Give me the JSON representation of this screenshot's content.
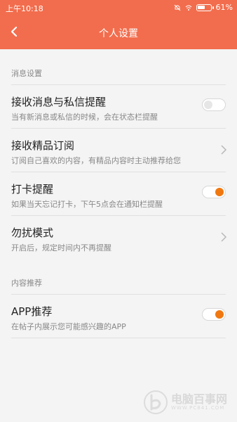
{
  "status": {
    "time": "上午10:18",
    "battery_percent": "61%",
    "battery_level": 0.61
  },
  "header": {
    "title": "个人设置",
    "background": "#f26d4d"
  },
  "sections": [
    {
      "label": "消息设置",
      "rows": [
        {
          "title": "接收消息与私信提醒",
          "subtitle": "当有新消息或私信的时候，会在状态栏提醒",
          "control": "toggle",
          "on": false
        },
        {
          "title": "接收精品订阅",
          "subtitle": "订阅自己喜欢的内容，有精品内容时主动推荐给您",
          "control": "chevron"
        },
        {
          "title": "打卡提醒",
          "subtitle": "如果当天忘记打卡，下午5点会在通知栏提醒",
          "control": "toggle",
          "on": true
        },
        {
          "title": "勿扰模式",
          "subtitle": "开启后，规定时间内不再提醒",
          "control": "chevron"
        }
      ]
    },
    {
      "label": "内容推荐",
      "rows": [
        {
          "title": "APP推荐",
          "subtitle": "在帖子内展示您可能感兴趣的APP",
          "control": "toggle",
          "on": true
        }
      ]
    }
  ],
  "watermark": {
    "text": "电脑百事网",
    "url": "WWW.PC841.COM"
  },
  "colors": {
    "accent": "#f07810",
    "text": "#222222",
    "subtext": "#888888"
  }
}
